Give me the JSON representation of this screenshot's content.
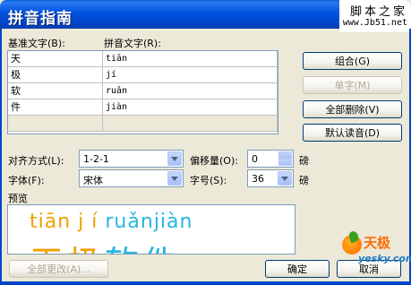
{
  "window": {
    "title": "拼音指南"
  },
  "watermark": {
    "line1": "脚本之家",
    "line2": "www.Jb51.net"
  },
  "table": {
    "base_header": "基准文字(B):",
    "pinyin_header": "拼音文字(R):",
    "rows": [
      {
        "base": "天",
        "pinyin": "tiān"
      },
      {
        "base": "极",
        "pinyin": "jí"
      },
      {
        "base": "软",
        "pinyin": "ruǎn"
      },
      {
        "base": "件",
        "pinyin": "jiàn"
      }
    ]
  },
  "buttons": {
    "group": "组合(G)",
    "single": "单字(M)",
    "clear_all": "全部删除(V)",
    "default_reading": "默认读音(D)",
    "change_all": "全部更改(A)...",
    "ok": "确定",
    "cancel": "取消"
  },
  "options": {
    "alignment_label": "对齐方式(L):",
    "alignment_value": "1-2-1",
    "offset_label": "偏移量(O):",
    "offset_value": "0",
    "offset_unit": "磅",
    "font_label": "字体(F):",
    "font_value": "宋体",
    "size_label": "字号(S):",
    "size_value": "36",
    "size_unit": "磅"
  },
  "preview": {
    "label": "预览",
    "pinyin": [
      {
        "text": "tiān",
        "color": "orange"
      },
      {
        "text": "j í",
        "color": "orange"
      },
      {
        "text": "ruǎn",
        "color": "blue"
      },
      {
        "text": "jiàn",
        "color": "blue"
      }
    ],
    "chars": [
      {
        "text": "天",
        "color": "orange"
      },
      {
        "text": "极",
        "color": "orange"
      },
      {
        "text": "软",
        "color": "blue"
      },
      {
        "text": "件",
        "color": "blue"
      }
    ]
  },
  "logo": {
    "text1": "天极",
    "text2": "yesky.com"
  },
  "colors": {
    "title_bar": "#0052e0",
    "orange": "#f0a000",
    "blue": "#28b4e0"
  }
}
